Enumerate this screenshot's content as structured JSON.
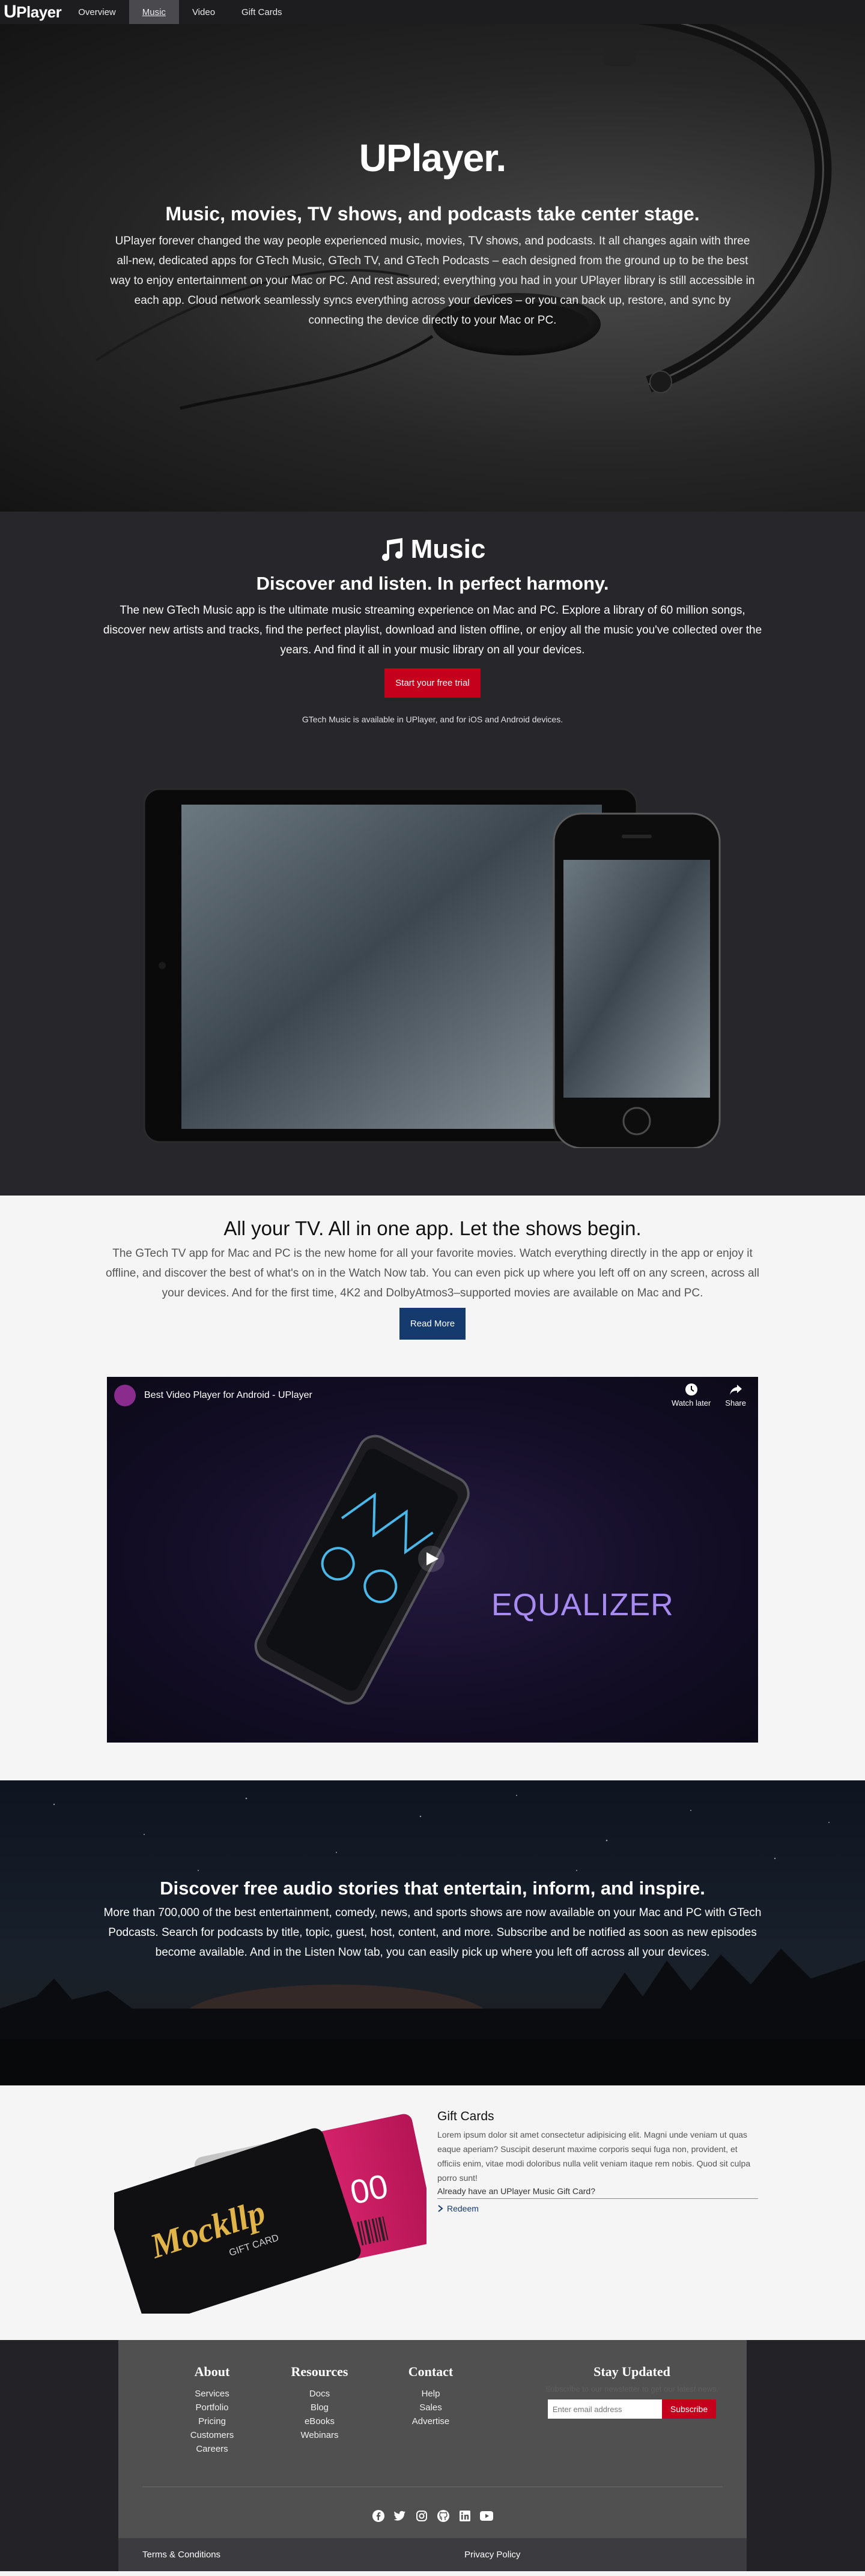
{
  "nav": {
    "brand_u": "U",
    "brand_rest": "Player",
    "links": [
      "Overview",
      "Music",
      "Video",
      "Gift Cards"
    ],
    "active": "Music"
  },
  "hero": {
    "title": "UPlayer.",
    "subtitle": "Music, movies, TV shows, and podcasts take center stage.",
    "body": "UPlayer forever changed the way people experienced music, movies, TV shows, and podcasts. It all changes again with three all-new, dedicated apps for GTech Music, GTech TV, and GTech Podcasts – each designed from the ground up to be the best way to enjoy entertainment on your Mac or PC. And rest assured; everything you had in your UPlayer library is still accessible in each app. Cloud network seamlessly syncs everything across your devices – or you can back up, restore, and sync by connecting the device directly to your Mac or PC."
  },
  "music": {
    "title": "Music",
    "icon": "music-note-icon",
    "subtitle": "Discover and listen. In perfect harmony.",
    "body": "The new GTech Music app is the ultimate music streaming experience on Mac and PC. Explore a library of 60 million songs, discover new artists and tracks, find the perfect playlist, download and listen offline, or enjoy all the music you've collected over the years. And find it all in your music library on all your devices.",
    "cta": "Start your free trial",
    "availability": "GTech Music is available in UPlayer, and for iOS and Android devices."
  },
  "tv": {
    "title": "All your TV. All in one app. Let the shows begin.",
    "body": "The GTech TV app for Mac and PC is the new home for all your favorite movies. Watch everything directly in the app or enjoy it offline, and discover the best of what's on in the Watch Now tab. You can even pick up where you left off on any screen, across all your devices. And for the first time, 4K2 and DolbyAtmos3–supported movies are available on Mac and PC.",
    "cta": "Read More",
    "video": {
      "title": "Best Video Player for Android - UPlayer",
      "watch_later": "Watch later",
      "share": "Share",
      "overlay_text": "EQUALIZER"
    }
  },
  "stories": {
    "title": "Discover free audio stories that entertain, inform, and inspire.",
    "body": "More than 700,000 of the best entertainment, comedy, news, and sports shows are now available on your Mac and PC with GTech Podcasts. Search for podcasts by title, topic, guest, host, content, and more. Subscribe and be notified as soon as new episodes become available. And in the Listen Now tab, you can easily pick up where you left off across all your devices."
  },
  "gift": {
    "title": "Gift Cards",
    "body": "Lorem ipsum dolor sit amet consectetur adipisicing elit. Magni unde veniam ut quas eaque aperiam? Suscipit deserunt maxime corporis sequi fuga non, provident, et officiis enim, vitae modi doloribus nulla velit veniam itaque rem nobis. Quod sit culpa porro sunt!",
    "already": "Already have an UPlayer Music Gift Card?",
    "redeem": "Redeem",
    "card_brand": "Mockllp",
    "card_sub": "GIFT CARD",
    "card_back": "00"
  },
  "footer": {
    "columns": [
      {
        "title": "About",
        "links": [
          "Services",
          "Portfolio",
          "Pricing",
          "Customers",
          "Careers"
        ]
      },
      {
        "title": "Resources",
        "links": [
          "Docs",
          "Blog",
          "eBooks",
          "Webinars"
        ]
      },
      {
        "title": "Contact",
        "links": [
          "Help",
          "Sales",
          "Advertise"
        ]
      }
    ],
    "newsletter": {
      "title": "Stay Updated",
      "hint": "Subscribe to our newsletter to get our latest news.",
      "placeholder": "Enter email address",
      "button": "Subscribe"
    },
    "socials": [
      "facebook-icon",
      "twitter-icon",
      "instagram-icon",
      "github-icon",
      "linkedin-icon",
      "youtube-icon"
    ],
    "terms": "Terms & Conditions",
    "privacy": "Privacy Policy"
  },
  "colors": {
    "accent_red": "#c4001d",
    "navy": "#143a6e",
    "dark": "#26262b"
  }
}
